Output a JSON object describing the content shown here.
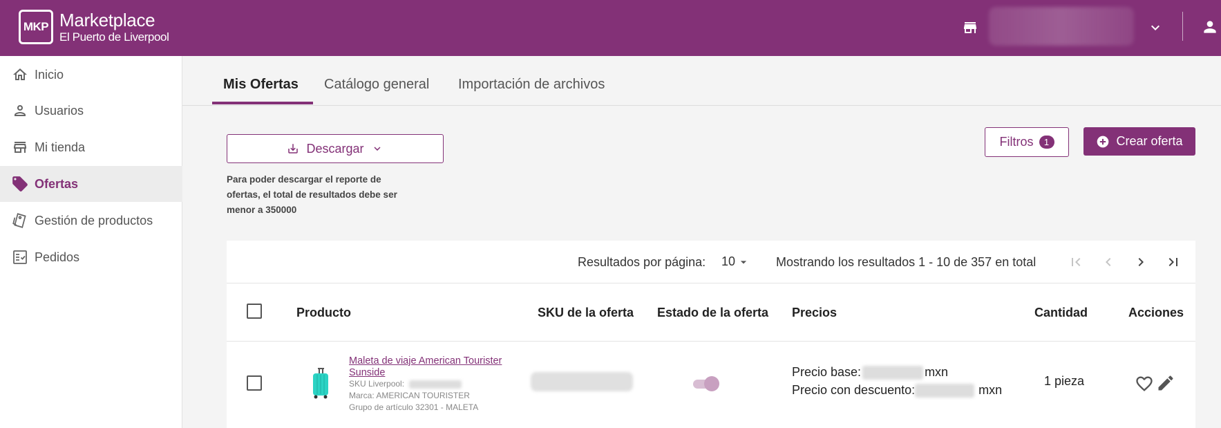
{
  "header": {
    "logo_text": "MKP",
    "app_title": "Marketplace",
    "app_subtitle": "El Puerto de Liverpool"
  },
  "sidebar": {
    "items": [
      {
        "label": "Inicio",
        "icon": "home-icon",
        "active": false
      },
      {
        "label": "Usuarios",
        "icon": "person-icon",
        "active": false
      },
      {
        "label": "Mi tienda",
        "icon": "store-icon",
        "active": false
      },
      {
        "label": "Ofertas",
        "icon": "tag-icon",
        "active": true
      },
      {
        "label": "Gestión de productos",
        "icon": "tags-icon",
        "active": false
      },
      {
        "label": "Pedidos",
        "icon": "checklist-icon",
        "active": false
      }
    ]
  },
  "tabs": [
    {
      "label": "Mis Ofertas",
      "active": true
    },
    {
      "label": "Catálogo general",
      "active": false
    },
    {
      "label": "Importación de archivos",
      "active": false
    }
  ],
  "actions": {
    "download_label": "Descargar",
    "download_note": "Para poder descargar el reporte de ofertas, el total de resultados debe ser menor a 350000",
    "filters_label": "Filtros",
    "filters_count": "1",
    "create_label": "Crear oferta"
  },
  "pagination": {
    "per_page_label": "Resultados por página:",
    "per_page_value": "10",
    "range_text": "Mostrando los resultados 1 - 10 de 357 en total"
  },
  "table": {
    "columns": [
      "Producto",
      "SKU de la oferta",
      "Estado de la oferta",
      "Precios",
      "Cantidad",
      "Acciones"
    ],
    "rows": [
      {
        "title": "Maleta de viaje American Tourister Sunside",
        "sku_label": "SKU Liverpool:",
        "brand": "Marca: AMERICAN TOURISTER",
        "group": "Grupo de artículo 32301 - MALETA",
        "base_price_label": "Precio base:",
        "discount_price_label": "Precio con descuento:",
        "currency": "mxn",
        "quantity": "1 pieza",
        "state_on": true
      }
    ]
  },
  "colors": {
    "brand": "#833177",
    "background": "#f4f4f4"
  }
}
